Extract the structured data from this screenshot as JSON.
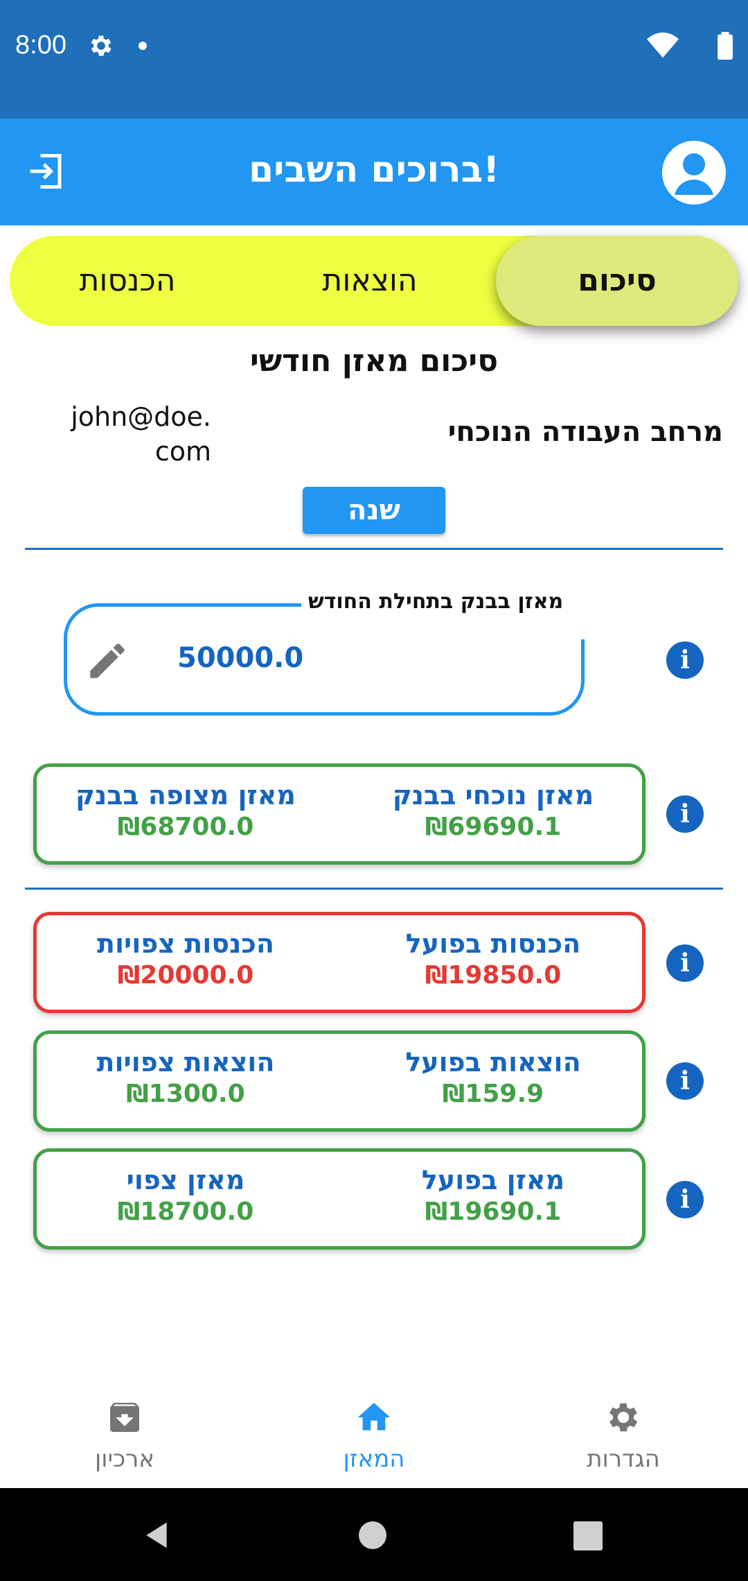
{
  "status_bar": {
    "time": "8:00"
  },
  "app_bar": {
    "title": "ברוכים השבים!",
    "logout_icon": "logout-icon",
    "profile_icon": "account-circle-icon"
  },
  "tabs": [
    {
      "label": "סיכום",
      "selected": true
    },
    {
      "label": "הוצאות",
      "selected": false
    },
    {
      "label": "הכנסות",
      "selected": false
    }
  ],
  "summary": {
    "title": "סיכום מאזן חודשי",
    "workspace_label": "מרחב העבודה הנוכחי",
    "workspace_email": "john@doe.com",
    "change_button": "שנה",
    "opening_balance": {
      "label": "מאזן בבנק בתחילת החודש",
      "value": "50000.0"
    },
    "cards": [
      {
        "status": "green",
        "right_label": "מאזן נוכחי בבנק",
        "right_value": "₪69690.1",
        "left_label": "מאזן מצופה בבנק",
        "left_value": "₪68700.0"
      },
      {
        "status": "red",
        "right_label": "הכנסות בפועל",
        "right_value": "₪19850.0",
        "left_label": "הכנסות צפויות",
        "left_value": "₪20000.0"
      },
      {
        "status": "green",
        "right_label": "הוצאות בפועל",
        "right_value": "₪159.9",
        "left_label": "הוצאות צפויות",
        "left_value": "₪1300.0"
      },
      {
        "status": "green",
        "right_label": "מאזן בפועל",
        "right_value": "₪19690.1",
        "left_label": "מאזן צפוי",
        "left_value": "₪18700.0"
      }
    ]
  },
  "bottom_nav": [
    {
      "label": "ארכיון",
      "icon": "archive-icon",
      "active": false
    },
    {
      "label": "המאזן",
      "icon": "home-icon",
      "active": true
    },
    {
      "label": "הגדרות",
      "icon": "settings-icon",
      "active": false
    }
  ],
  "colors": {
    "status_bar": "#1f6fbb",
    "app_bar": "#2196f3",
    "tabs_bg": "#eeff41",
    "tab_selected": "#dde97a",
    "label_blue": "#1565c0",
    "green": "#43a047",
    "red": "#e53935"
  }
}
